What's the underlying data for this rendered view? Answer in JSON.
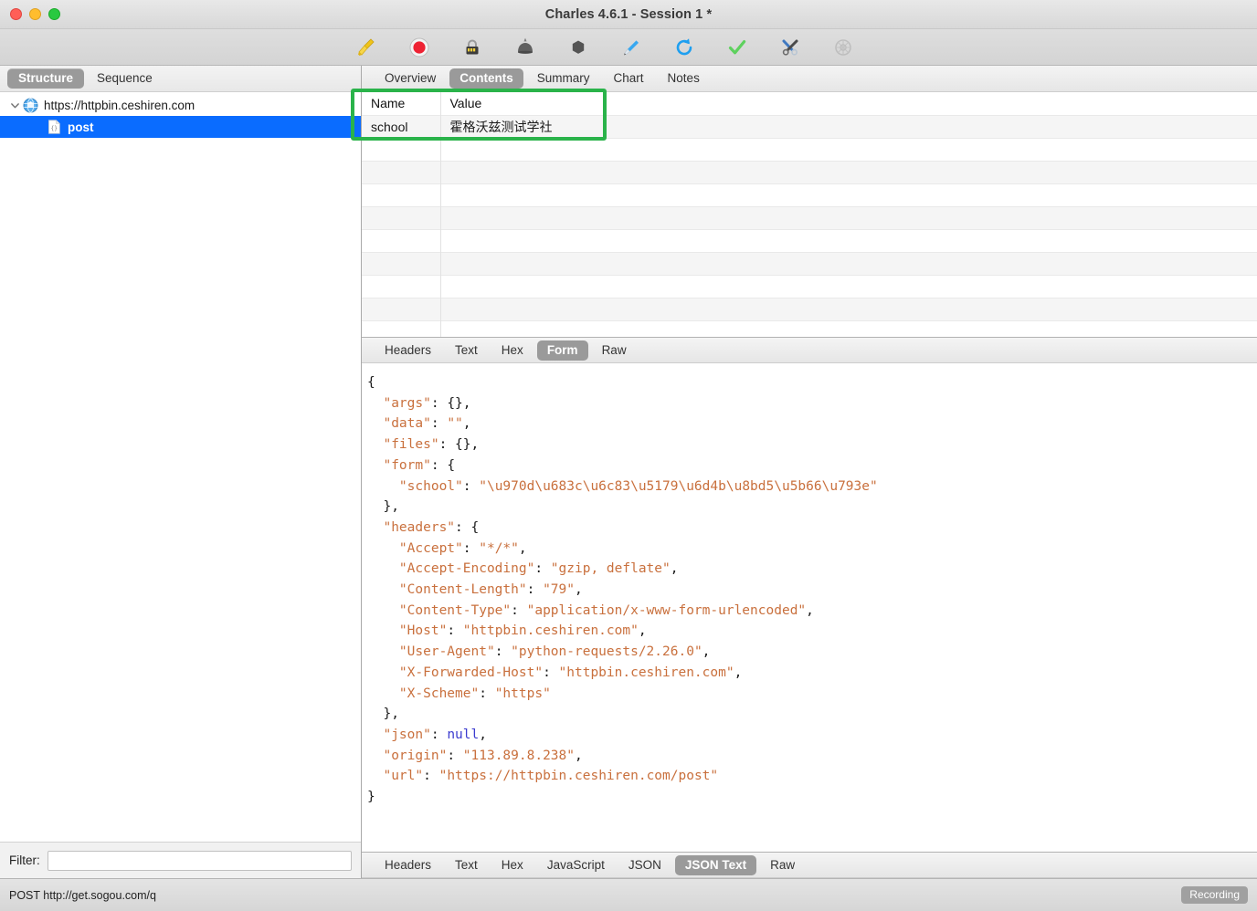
{
  "window": {
    "title": "Charles 4.6.1 - Session 1 *",
    "traffic_lights": [
      "close",
      "minimize",
      "zoom"
    ]
  },
  "toolbar": {
    "items": [
      {
        "name": "clear-broom-icon",
        "label": "Clear",
        "enabled": true
      },
      {
        "name": "record-icon",
        "label": "Start Recording",
        "enabled": true
      },
      {
        "name": "throttle-icon",
        "label": "Throttle",
        "enabled": true
      },
      {
        "name": "breakpoints-icon",
        "label": "Breakpoints",
        "enabled": true
      },
      {
        "name": "compose-icon",
        "label": "Compose",
        "enabled": true
      },
      {
        "name": "edit-pen-icon",
        "label": "Edit",
        "enabled": true
      },
      {
        "name": "repeat-refresh-icon",
        "label": "Repeat",
        "enabled": true
      },
      {
        "name": "validate-check-icon",
        "label": "Validate",
        "enabled": true
      },
      {
        "name": "tools-icon",
        "label": "Tools",
        "enabled": true
      },
      {
        "name": "dns-spoof-icon",
        "label": "DNS Spoofing",
        "enabled": false
      }
    ]
  },
  "sidebar": {
    "segments": [
      {
        "label": "Structure",
        "active": true
      },
      {
        "label": "Sequence",
        "active": false
      }
    ],
    "tree": [
      {
        "label": "https://httpbin.ceshiren.com",
        "icon": "globe-icon",
        "level": 1,
        "expanded": true,
        "selected": false
      },
      {
        "label": "post",
        "icon": "json-file-icon",
        "level": 2,
        "expanded": false,
        "selected": true
      }
    ],
    "filter": {
      "label": "Filter:",
      "value": "",
      "placeholder": ""
    }
  },
  "detail": {
    "top_tabs": [
      {
        "label": "Overview",
        "active": false
      },
      {
        "label": "Contents",
        "active": true
      },
      {
        "label": "Summary",
        "active": false
      },
      {
        "label": "Chart",
        "active": false
      },
      {
        "label": "Notes",
        "active": false
      }
    ],
    "kv_table": {
      "columns": [
        "Name",
        "Value"
      ],
      "rows": [
        {
          "name": "school",
          "value": "霍格沃兹测试学社"
        }
      ],
      "empty_rows": 8
    },
    "annotation": {
      "shape": "rectangle",
      "color": "#2ab34a",
      "target": "name-value-table"
    },
    "request_tabs": [
      {
        "label": "Headers",
        "active": false
      },
      {
        "label": "Text",
        "active": false
      },
      {
        "label": "Hex",
        "active": false
      },
      {
        "label": "Form",
        "active": true
      },
      {
        "label": "Raw",
        "active": false
      }
    ],
    "response_tabs": [
      {
        "label": "Headers",
        "active": false
      },
      {
        "label": "Text",
        "active": false
      },
      {
        "label": "Hex",
        "active": false
      },
      {
        "label": "JavaScript",
        "active": false
      },
      {
        "label": "JSON",
        "active": false
      },
      {
        "label": "JSON Text",
        "active": true
      },
      {
        "label": "Raw",
        "active": false
      }
    ],
    "json_body": [
      {
        "indent": 0,
        "parts": [
          {
            "t": "{",
            "c": "punct"
          }
        ]
      },
      {
        "indent": 1,
        "parts": [
          {
            "t": "\"args\"",
            "c": "key"
          },
          {
            "t": ": ",
            "c": "punct"
          },
          {
            "t": "{}",
            "c": "punct"
          },
          {
            "t": ",",
            "c": "punct"
          }
        ]
      },
      {
        "indent": 1,
        "parts": [
          {
            "t": "\"data\"",
            "c": "key"
          },
          {
            "t": ": ",
            "c": "punct"
          },
          {
            "t": "\"\"",
            "c": "str"
          },
          {
            "t": ",",
            "c": "punct"
          }
        ]
      },
      {
        "indent": 1,
        "parts": [
          {
            "t": "\"files\"",
            "c": "key"
          },
          {
            "t": ": ",
            "c": "punct"
          },
          {
            "t": "{}",
            "c": "punct"
          },
          {
            "t": ",",
            "c": "punct"
          }
        ]
      },
      {
        "indent": 1,
        "parts": [
          {
            "t": "\"form\"",
            "c": "key"
          },
          {
            "t": ": ",
            "c": "punct"
          },
          {
            "t": "{",
            "c": "punct"
          }
        ]
      },
      {
        "indent": 2,
        "parts": [
          {
            "t": "\"school\"",
            "c": "key"
          },
          {
            "t": ": ",
            "c": "punct"
          },
          {
            "t": "\"\\u970d\\u683c\\u6c83\\u5179\\u6d4b\\u8bd5\\u5b66\\u793e\"",
            "c": "str"
          }
        ]
      },
      {
        "indent": 1,
        "parts": [
          {
            "t": "}",
            "c": "punct"
          },
          {
            "t": ",",
            "c": "punct"
          }
        ]
      },
      {
        "indent": 1,
        "parts": [
          {
            "t": "\"headers\"",
            "c": "key"
          },
          {
            "t": ": ",
            "c": "punct"
          },
          {
            "t": "{",
            "c": "punct"
          }
        ]
      },
      {
        "indent": 2,
        "parts": [
          {
            "t": "\"Accept\"",
            "c": "key"
          },
          {
            "t": ": ",
            "c": "punct"
          },
          {
            "t": "\"*/*\"",
            "c": "str"
          },
          {
            "t": ",",
            "c": "punct"
          }
        ]
      },
      {
        "indent": 2,
        "parts": [
          {
            "t": "\"Accept-Encoding\"",
            "c": "key"
          },
          {
            "t": ": ",
            "c": "punct"
          },
          {
            "t": "\"gzip, deflate\"",
            "c": "str"
          },
          {
            "t": ",",
            "c": "punct"
          }
        ]
      },
      {
        "indent": 2,
        "parts": [
          {
            "t": "\"Content-Length\"",
            "c": "key"
          },
          {
            "t": ": ",
            "c": "punct"
          },
          {
            "t": "\"79\"",
            "c": "str"
          },
          {
            "t": ",",
            "c": "punct"
          }
        ]
      },
      {
        "indent": 2,
        "parts": [
          {
            "t": "\"Content-Type\"",
            "c": "key"
          },
          {
            "t": ": ",
            "c": "punct"
          },
          {
            "t": "\"application/x-www-form-urlencoded\"",
            "c": "str"
          },
          {
            "t": ",",
            "c": "punct"
          }
        ]
      },
      {
        "indent": 2,
        "parts": [
          {
            "t": "\"Host\"",
            "c": "key"
          },
          {
            "t": ": ",
            "c": "punct"
          },
          {
            "t": "\"httpbin.ceshiren.com\"",
            "c": "str"
          },
          {
            "t": ",",
            "c": "punct"
          }
        ]
      },
      {
        "indent": 2,
        "parts": [
          {
            "t": "\"User-Agent\"",
            "c": "key"
          },
          {
            "t": ": ",
            "c": "punct"
          },
          {
            "t": "\"python-requests/2.26.0\"",
            "c": "str"
          },
          {
            "t": ",",
            "c": "punct"
          }
        ]
      },
      {
        "indent": 2,
        "parts": [
          {
            "t": "\"X-Forwarded-Host\"",
            "c": "key"
          },
          {
            "t": ": ",
            "c": "punct"
          },
          {
            "t": "\"httpbin.ceshiren.com\"",
            "c": "str"
          },
          {
            "t": ",",
            "c": "punct"
          }
        ]
      },
      {
        "indent": 2,
        "parts": [
          {
            "t": "\"X-Scheme\"",
            "c": "key"
          },
          {
            "t": ": ",
            "c": "punct"
          },
          {
            "t": "\"https\"",
            "c": "str"
          }
        ]
      },
      {
        "indent": 1,
        "parts": [
          {
            "t": "}",
            "c": "punct"
          },
          {
            "t": ",",
            "c": "punct"
          }
        ]
      },
      {
        "indent": 1,
        "parts": [
          {
            "t": "\"json\"",
            "c": "key"
          },
          {
            "t": ": ",
            "c": "punct"
          },
          {
            "t": "null",
            "c": "null"
          },
          {
            "t": ",",
            "c": "punct"
          }
        ]
      },
      {
        "indent": 1,
        "parts": [
          {
            "t": "\"origin\"",
            "c": "key"
          },
          {
            "t": ": ",
            "c": "punct"
          },
          {
            "t": "\"113.89.8.238\"",
            "c": "str"
          },
          {
            "t": ",",
            "c": "punct"
          }
        ]
      },
      {
        "indent": 1,
        "parts": [
          {
            "t": "\"url\"",
            "c": "key"
          },
          {
            "t": ": ",
            "c": "punct"
          },
          {
            "t": "\"https://httpbin.ceshiren.com/post\"",
            "c": "str"
          }
        ]
      },
      {
        "indent": 0,
        "parts": [
          {
            "t": "}",
            "c": "punct"
          }
        ]
      }
    ]
  },
  "statusbar": {
    "text": "POST http://get.sogou.com/q",
    "recording_badge": "Recording"
  },
  "colors": {
    "selection_blue": "#0a6cff",
    "annotation_green": "#2ab34a",
    "tab_active_gray": "#9a9a9a",
    "json_string_orange": "#c9703d",
    "json_null_blue": "#3b3bcf",
    "record_red": "#ee2233"
  }
}
